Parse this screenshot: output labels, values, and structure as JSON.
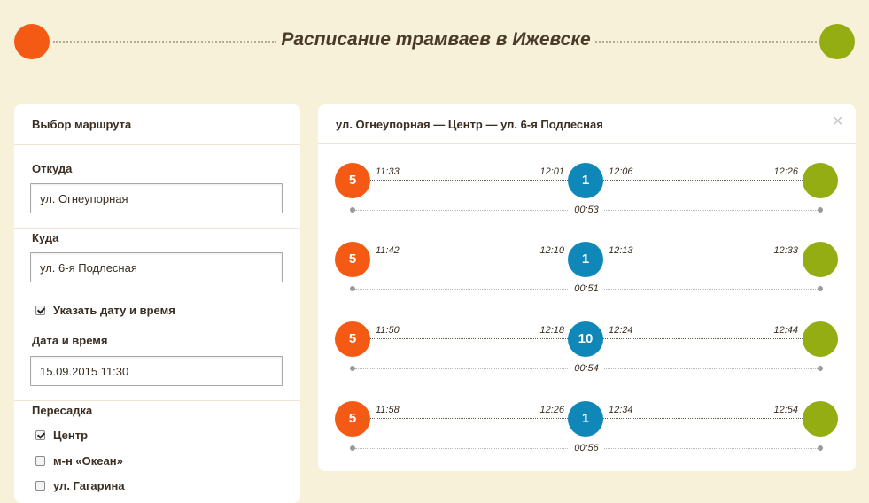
{
  "header": {
    "title": "Расписание трамваев в Ижевске",
    "colors": {
      "start": "#f55a14",
      "finish": "#93ad12",
      "transfer": "#0f87b8",
      "background": "#f8f1d9"
    }
  },
  "form": {
    "panel_title": "Выбор маршрута",
    "from_label": "Откуда",
    "from_value": "ул. Огнеупорная",
    "to_label": "Куда",
    "to_value": "ул. 6-я Подлесная",
    "specify_datetime_label": "Указать дату и время",
    "specify_datetime_checked": true,
    "datetime_label": "Дата и время",
    "datetime_value": "15.09.2015 11:30",
    "transfer_label": "Пересадка",
    "transfer_options": [
      {
        "label": "Центр",
        "checked": true
      },
      {
        "label": "м-н «Океан»",
        "checked": false
      },
      {
        "label": "ул. Гагарина",
        "checked": false
      }
    ]
  },
  "results": {
    "route_title": "ул. Огнеупорная — Центр — ул. 6-я Подлесная",
    "close_icon": "close-icon",
    "trips": [
      {
        "first_tram": "5",
        "depart": "11:33",
        "arrive_transfer": "12:01",
        "second_tram": "1",
        "depart_transfer": "12:06",
        "arrive": "12:26",
        "duration": "00:53"
      },
      {
        "first_tram": "5",
        "depart": "11:42",
        "arrive_transfer": "12:10",
        "second_tram": "1",
        "depart_transfer": "12:13",
        "arrive": "12:33",
        "duration": "00:51"
      },
      {
        "first_tram": "5",
        "depart": "11:50",
        "arrive_transfer": "12:18",
        "second_tram": "10",
        "depart_transfer": "12:24",
        "arrive": "12:44",
        "duration": "00:54"
      },
      {
        "first_tram": "5",
        "depart": "11:58",
        "arrive_transfer": "12:26",
        "second_tram": "1",
        "depart_transfer": "12:34",
        "arrive": "12:54",
        "duration": "00:56"
      }
    ]
  }
}
